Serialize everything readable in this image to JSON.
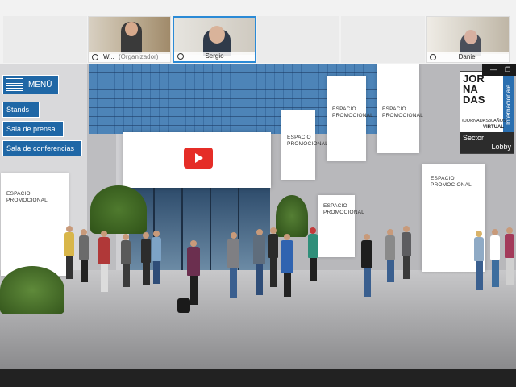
{
  "participants": [
    {
      "name": "W...",
      "role": "(Organizador)"
    },
    {
      "name": "Sergio",
      "role": ""
    },
    {
      "name": "Daniel",
      "role": ""
    }
  ],
  "menu": {
    "label": "MENÚ",
    "items": [
      "Stands",
      "Sala de prensa",
      "Sala de conferencias"
    ]
  },
  "promo_label": "ESPACIO PROMOCIONAL",
  "sign": {
    "letters": "JOR NA DAS",
    "side": "Internacionale",
    "hashtag": "#JORNADAS30AÑOS",
    "virtual": "VIRTUAL",
    "sector": "Sector",
    "lobby": "Lobby"
  },
  "window_controls": {
    "minimize": "—",
    "restore": "❐"
  },
  "colors": {
    "menu_blue": "#1f67a6",
    "active_border": "#2b8ad6",
    "play_red": "#e52d27"
  }
}
